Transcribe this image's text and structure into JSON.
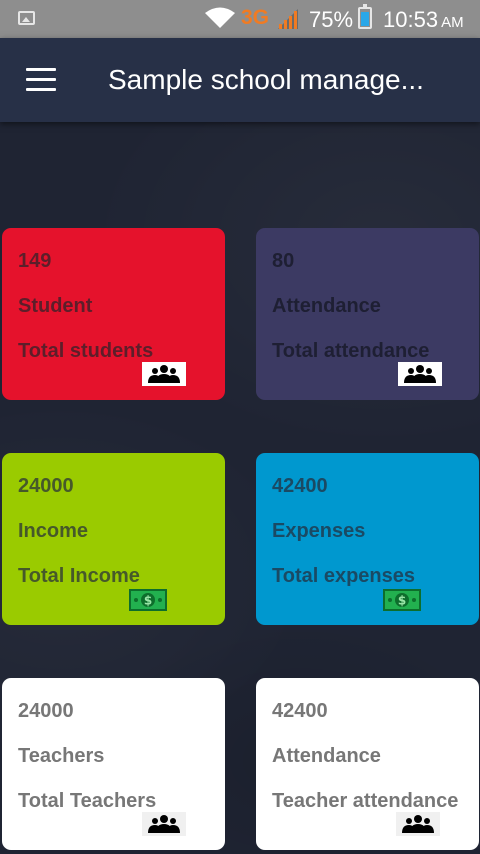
{
  "status_bar": {
    "network": "3G",
    "battery_percent": "75%",
    "time": "10:53",
    "ampm": "AM",
    "icons": [
      "gallery-icon",
      "wifi-icon",
      "signal-icon",
      "battery-icon"
    ]
  },
  "app_bar": {
    "title": "Sample school manage...",
    "menu_icon": "hamburger-menu-icon"
  },
  "colors": {
    "background": "#1f2433",
    "app_bar": "#273047",
    "students_card": "#e5122c",
    "attendance_card": "#3c3a63",
    "income_card": "#9acb00",
    "expenses_card": "#0098cf",
    "teachers_card": "#ffffff",
    "teacher_attendance_card": "#ffffff"
  },
  "cards": [
    {
      "value": "149",
      "title": "Student",
      "subtitle": "Total students",
      "icon": "people-icon"
    },
    {
      "value": "80",
      "title": "Attendance",
      "subtitle": "Total attendance",
      "icon": "people-icon"
    },
    {
      "value": "24000",
      "title": "Income",
      "subtitle": "Total Income",
      "icon": "money-icon"
    },
    {
      "value": "42400",
      "title": "Expenses",
      "subtitle": "Total expenses",
      "icon": "money-icon"
    },
    {
      "value": "24000",
      "title": "Teachers",
      "subtitle": "Total Teachers",
      "icon": "people-icon"
    },
    {
      "value": "42400",
      "title": "Attendance",
      "subtitle": "Teacher attendance",
      "icon": "people-icon"
    }
  ]
}
